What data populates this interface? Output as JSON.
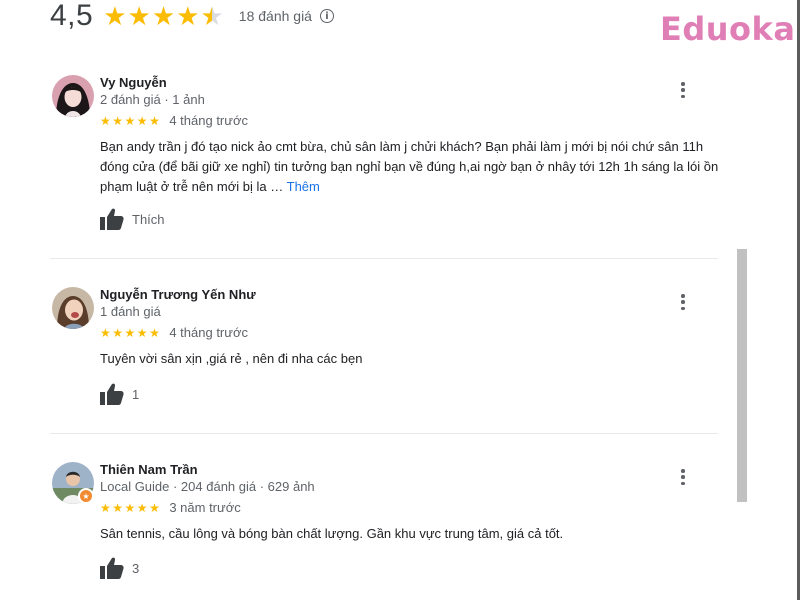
{
  "summary": {
    "rating": "4,5",
    "stars_value": 4.5,
    "review_count": "18 đánh giá",
    "info_icon": "info-icon"
  },
  "brand": {
    "text": "Eduoka",
    "color": "#e07fb6"
  },
  "colors": {
    "star": "#fbbc04",
    "link": "#1a73e8",
    "muted": "#5f6368",
    "divider": "#e8eaed"
  },
  "reviews": [
    {
      "name": "Vy Nguyễn",
      "meta": "2 đánh giá · 1 ảnh",
      "stars": 5,
      "date": "4 tháng trước",
      "text": "Bạn andy trần j đó tạo nick ảo cmt bừa, chủ sân làm j chửi khách? Bạn phải làm j mới bị nói chứ sân 11h đóng cửa (để bãi giữ xe nghỉ) tin tưởng bạn nghỉ bạn về đúng h,ai ngờ bạn ở nhây tới 12h 1h sáng la lói ồn phạm luật ở trễ nên mới bị la …",
      "more": "Thêm",
      "like_label": "Thích"
    },
    {
      "name": "Nguyễn Trương Yến Như",
      "meta": "1 đánh giá",
      "stars": 5,
      "date": "4 tháng trước",
      "text": "Tuyên vời sân xịn ,giá rẻ , nên đi nha các bẹn",
      "like_label": "1"
    },
    {
      "name": "Thiên Nam Trần",
      "meta": "Local Guide · 204 đánh giá · 629 ảnh",
      "stars": 5,
      "date": "3 năm trước",
      "text": "Sân tennis, cầu lông và bóng bàn chất lượng. Gần khu vực trung tâm, giá cả tốt.",
      "like_label": "3"
    }
  ]
}
